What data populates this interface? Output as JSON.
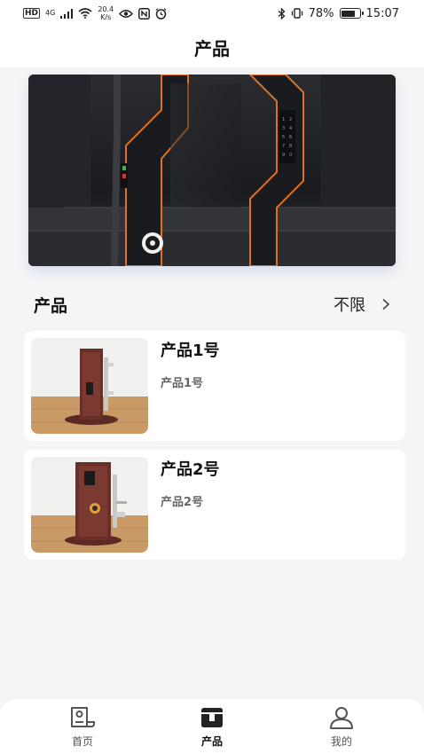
{
  "status_bar": {
    "hd": "HD",
    "net": "4G",
    "speed_value": "20.4",
    "speed_unit": "K/s",
    "battery_percent": "78%",
    "battery_level": 0.78,
    "time": "15:07"
  },
  "header": {
    "title": "产品"
  },
  "section": {
    "title": "产品",
    "filter_label": "不限"
  },
  "products": [
    {
      "name": "产品1号",
      "subtitle": "产品1号"
    },
    {
      "name": "产品2号",
      "subtitle": "产品2号"
    }
  ],
  "tabs": [
    {
      "label": "首页",
      "icon": "home-icon",
      "active": false
    },
    {
      "label": "产品",
      "icon": "product-box-icon",
      "active": true
    },
    {
      "label": "我的",
      "icon": "profile-icon",
      "active": false
    }
  ],
  "colors": {
    "background": "#f5f5f5",
    "card": "#ffffff",
    "accent_orange": "#e07020",
    "tab_active": "#222222"
  }
}
